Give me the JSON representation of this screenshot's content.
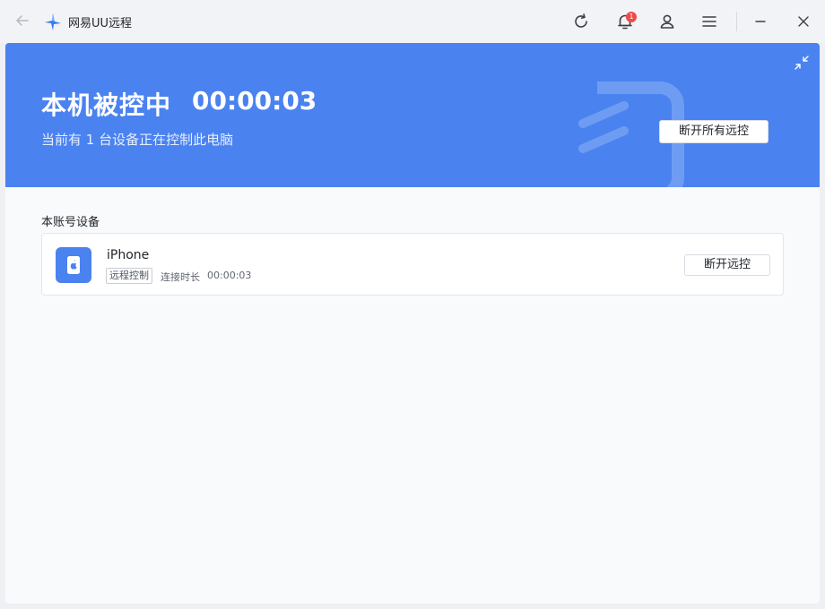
{
  "titlebar": {
    "app_title": "网易UU远程",
    "notification_count": "1",
    "icons": [
      "back-arrow-icon",
      "app-logo-icon",
      "refresh-icon",
      "bell-icon",
      "user-icon",
      "menu-icon",
      "minimize-icon",
      "close-icon"
    ]
  },
  "banner": {
    "status_title": "本机被控中",
    "timer": "00:00:03",
    "subtitle": "当前有 1 台设备正在控制此电脑",
    "disconnect_all_label": "断开所有远控",
    "accent_color": "#4a82f0"
  },
  "devices": {
    "section_label": "本账号设备",
    "items": [
      {
        "name": "iPhone",
        "tag": "远程控制",
        "duration_label": "连接时长",
        "duration": "00:00:03",
        "action_label": "断开远控",
        "icon": "apple-phone-icon"
      }
    ]
  }
}
